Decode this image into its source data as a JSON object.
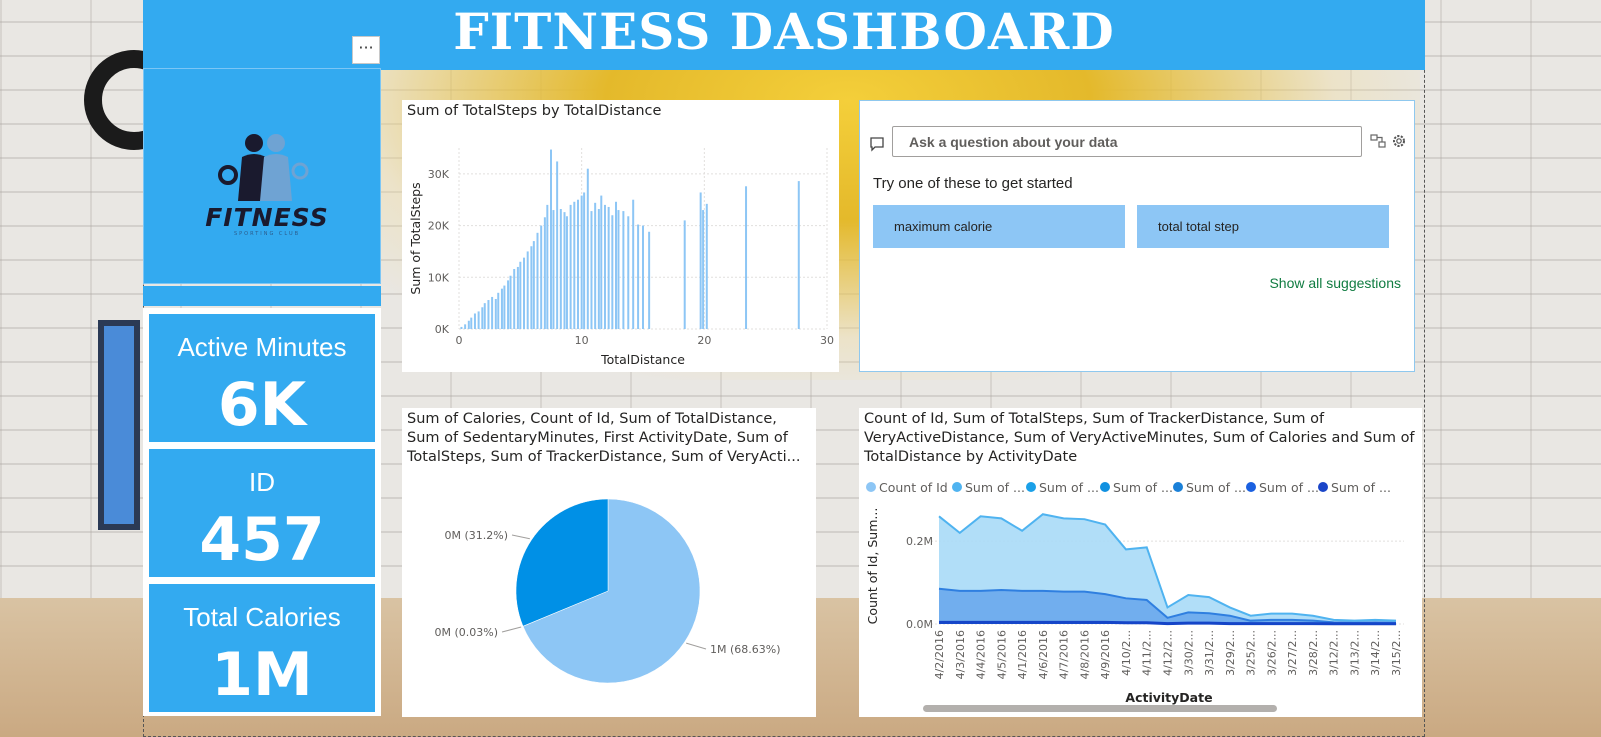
{
  "header": {
    "title": "FITNESS DASHBOARD",
    "more_label": "···"
  },
  "logo": {
    "brand": "FITNESS",
    "tagline": "SPORTING CLUB"
  },
  "kpis": [
    {
      "label": "Active Minutes",
      "value": "6K"
    },
    {
      "label": "ID",
      "value": "457"
    },
    {
      "label": "Total Calories",
      "value": "1M"
    }
  ],
  "colors": {
    "accent": "#33aaf0",
    "bar": "#8dc6f5",
    "pie_light": "#8dc6f5",
    "pie_dark": "#0090e6",
    "chip": "#8dc6f5",
    "link": "#107c41"
  },
  "qa": {
    "placeholder": "Ask a question about your data",
    "hint": "Try one of these to get started",
    "suggestions": [
      "maximum calorie",
      "total total step"
    ],
    "show_all": "Show all suggestions",
    "icons": [
      "chat-icon",
      "convert-visual-icon",
      "gear-icon"
    ]
  },
  "chart_data": [
    {
      "type": "bar",
      "title": "Sum of TotalSteps by TotalDistance",
      "xlabel": "TotalDistance",
      "ylabel": "Sum of TotalSteps",
      "xlim": [
        0,
        30
      ],
      "ylim": [
        0,
        35000
      ],
      "xticks": [
        "0",
        "10",
        "20",
        "30"
      ],
      "yticks": [
        "0K",
        "10K",
        "20K",
        "30K"
      ],
      "x": [
        0.2,
        0.5,
        0.8,
        1.0,
        1.3,
        1.6,
        1.9,
        2.1,
        2.4,
        2.7,
        3.0,
        3.2,
        3.5,
        3.7,
        4.0,
        4.2,
        4.5,
        4.8,
        5.0,
        5.3,
        5.6,
        5.9,
        6.1,
        6.4,
        6.7,
        7.0,
        7.2,
        7.5,
        7.7,
        8.0,
        8.3,
        8.6,
        8.8,
        9.1,
        9.4,
        9.7,
        10.0,
        10.2,
        10.5,
        10.8,
        11.1,
        11.4,
        11.6,
        11.9,
        12.2,
        12.5,
        12.8,
        13.0,
        13.4,
        13.8,
        14.2,
        14.6,
        15.0,
        15.5,
        18.4,
        19.7,
        19.9,
        20.2,
        23.4,
        27.7
      ],
      "values": [
        400,
        900,
        1600,
        2200,
        3000,
        3400,
        4200,
        5000,
        5600,
        6200,
        5800,
        7000,
        7800,
        8400,
        9400,
        10300,
        11600,
        12000,
        13000,
        13800,
        15000,
        16000,
        17000,
        18600,
        20000,
        21600,
        24000,
        34700,
        23000,
        32400,
        23200,
        22600,
        21800,
        24000,
        24600,
        25000,
        25800,
        26400,
        31000,
        22800,
        24400,
        23200,
        25800,
        24000,
        23600,
        22000,
        24600,
        23000,
        22800,
        21800,
        25000,
        20200,
        20000,
        18800,
        21000,
        26400,
        23000,
        24200,
        27600,
        28600
      ]
    },
    {
      "type": "pie",
      "title": "Sum of Calories, Count of Id, Sum of TotalDistance, Sum of SedentaryMinutes, First ActivityDate, Sum of TotalSteps, Sum of TrackerDistance, Sum of VeryActi...",
      "slices": [
        {
          "label": "1M (68.63%)",
          "value": 68.63
        },
        {
          "label": "0M (0.03%)",
          "value": 0.03
        },
        {
          "label": "0M (31.2%)",
          "value": 31.2
        }
      ]
    },
    {
      "type": "area",
      "title": "Count of Id, Sum of TotalSteps, Sum of TrackerDistance, Sum of VeryActiveDistance, Sum of VeryActiveMinutes, Sum of Calories and Sum of TotalDistance by ActivityDate",
      "xlabel": "ActivityDate",
      "ylabel": "Count of Id, Sum...",
      "ylim": [
        0,
        0.28
      ],
      "yticks": [
        "0.0M",
        "0.2M"
      ],
      "legend_position": "top",
      "legend": [
        "Count of Id",
        "Sum of ...",
        "Sum of ...",
        "Sum of ...",
        "Sum of ...",
        "Sum of ...",
        "Sum of ..."
      ],
      "categories": [
        "4/2/2016",
        "4/3/2016",
        "4/4/2016",
        "4/5/2016",
        "4/1/2016",
        "4/6/2016",
        "4/7/2016",
        "4/8/2016",
        "4/9/2016",
        "4/10/2...",
        "4/11/2...",
        "4/12/2...",
        "3/30/2...",
        "3/31/2...",
        "3/29/2...",
        "3/25/2...",
        "3/26/2...",
        "3/27/2...",
        "3/28/2...",
        "3/12/2...",
        "3/13/2...",
        "3/14/2...",
        "3/15/2..."
      ],
      "series": [
        {
          "name": "Count of Id",
          "values": [
            0.26,
            0.22,
            0.26,
            0.255,
            0.225,
            0.265,
            0.255,
            0.253,
            0.24,
            0.18,
            0.185,
            0.04,
            0.07,
            0.065,
            0.04,
            0.02,
            0.025,
            0.025,
            0.02,
            0.01,
            0.008,
            0.01,
            0.008
          ],
          "color": "#a8daf7"
        },
        {
          "values": [
            0.085,
            0.08,
            0.08,
            0.082,
            0.08,
            0.08,
            0.078,
            0.078,
            0.072,
            0.062,
            0.058,
            0.015,
            0.028,
            0.026,
            0.02,
            0.008,
            0.01,
            0.01,
            0.008,
            0.004,
            0.003,
            0.004,
            0.003
          ],
          "color": "#6aa8ec"
        },
        {
          "values": [
            0.004,
            0.004,
            0.004,
            0.004,
            0.004,
            0.004,
            0.004,
            0.004,
            0.004,
            0.003,
            0.003,
            0.001,
            0.002,
            0.002,
            0.001,
            0.001,
            0.001,
            0.001,
            0.001,
            0.0005,
            0.0005,
            0.0005,
            0.0005
          ],
          "color": "#1a56d6"
        }
      ]
    }
  ]
}
